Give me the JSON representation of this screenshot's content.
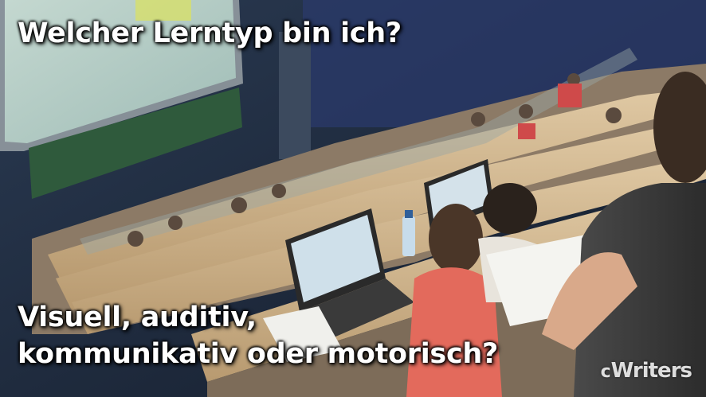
{
  "headline_top": "Welcher Lerntyp bin ich?",
  "headline_bottom": {
    "line1": "Visuell, auditiv,",
    "line2": "kommunikativ oder motorisch?"
  },
  "logo": {
    "text": "Writers"
  }
}
